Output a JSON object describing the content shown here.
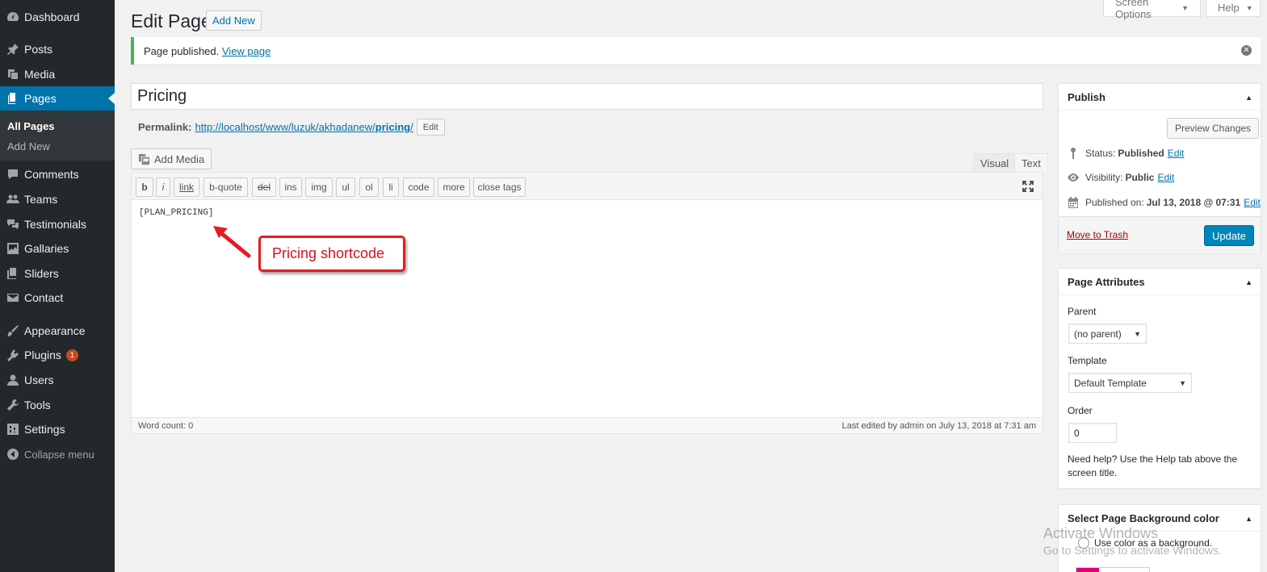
{
  "sidebar": {
    "items": [
      {
        "label": "Dashboard",
        "icon": "dashboard-icon"
      },
      {
        "label": "Posts",
        "icon": "pin-icon"
      },
      {
        "label": "Media",
        "icon": "media-icon"
      },
      {
        "label": "Pages",
        "icon": "pages-icon",
        "active": true
      },
      {
        "label": "Comments",
        "icon": "comments-icon"
      },
      {
        "label": "Teams",
        "icon": "teams-icon"
      },
      {
        "label": "Testimonials",
        "icon": "testimonials-icon"
      },
      {
        "label": "Gallaries",
        "icon": "gallery-icon"
      },
      {
        "label": "Sliders",
        "icon": "sliders-icon"
      },
      {
        "label": "Contact",
        "icon": "mail-icon"
      },
      {
        "label": "Appearance",
        "icon": "brush-icon"
      },
      {
        "label": "Plugins",
        "icon": "plugin-icon",
        "badge": "1"
      },
      {
        "label": "Users",
        "icon": "user-icon"
      },
      {
        "label": "Tools",
        "icon": "wrench-icon"
      },
      {
        "label": "Settings",
        "icon": "settings-icon"
      }
    ],
    "submenu": {
      "all_pages": "All Pages",
      "add_new": "Add New"
    },
    "collapse": "Collapse menu"
  },
  "top": {
    "screen_options": "Screen Options",
    "help": "Help",
    "heading": "Edit Page",
    "add_new": "Add New"
  },
  "notice": {
    "text": "Page published.",
    "link": "View page"
  },
  "title": "Pricing",
  "permalink": {
    "label": "Permalink:",
    "url_prefix": "http://localhost/www/luzuk/akhadanew/",
    "slug": "pricing",
    "url_suffix": "/",
    "edit": "Edit"
  },
  "editor": {
    "add_media": "Add Media",
    "tab_visual": "Visual",
    "tab_text": "Text",
    "quicktags": [
      "b",
      "i",
      "link",
      "b-quote",
      "del",
      "ins",
      "img",
      "ul",
      "ol",
      "li",
      "code",
      "more",
      "close tags"
    ],
    "content": "[PLAN_PRICING]",
    "word_count": "Word count: 0",
    "last_edited": "Last edited by admin on July 13, 2018 at 7:31 am"
  },
  "annotation": {
    "text": "Pricing shortcode",
    "color": "#e51c23"
  },
  "publish": {
    "title": "Publish",
    "preview": "Preview Changes",
    "status_label": "Status:",
    "status_value": "Published",
    "visibility_label": "Visibility:",
    "visibility_value": "Public",
    "published_on_label": "Published on:",
    "published_on_value": "Jul 13, 2018 @ 07:31",
    "edit": "Edit",
    "trash": "Move to Trash",
    "update": "Update"
  },
  "attributes": {
    "title": "Page Attributes",
    "parent_label": "Parent",
    "parent_value": "(no parent)",
    "template_label": "Template",
    "template_value": "Default Template",
    "order_label": "Order",
    "order_value": "0",
    "help": "Need help? Use the Help tab above the screen title."
  },
  "bgcolor": {
    "title": "Select Page Background color",
    "option": "Use color as a background."
  },
  "watermark": {
    "line1": "Activate Windows",
    "line2": "Go to Settings to activate Windows."
  }
}
